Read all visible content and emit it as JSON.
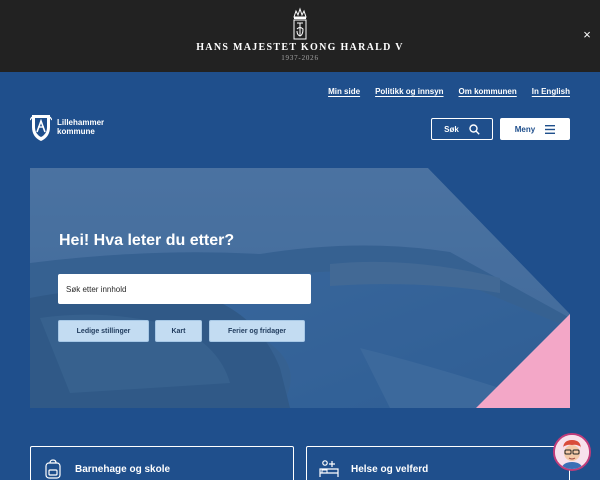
{
  "banner": {
    "title": "HANS MAJESTET KONG HARALD V",
    "years": "1937-2026",
    "close_icon": "×"
  },
  "header": {
    "links": [
      "Min side",
      "Politikk og innsyn",
      "Om kommunen",
      "In English"
    ],
    "logo_line1": "Lillehammer",
    "logo_line2": "kommune",
    "search_label": "Søk",
    "menu_label": "Meny"
  },
  "hero": {
    "title": "Hei! Hva leter du etter?",
    "search_placeholder": "Søk etter innhold",
    "quick_links": [
      "Ledige stillinger",
      "Kart",
      "Ferier og fridager"
    ]
  },
  "cards": [
    {
      "label": "Barnehage og skole",
      "icon": "backpack-icon"
    },
    {
      "label": "Helse og velferd",
      "icon": "care-bed-icon"
    }
  ],
  "colors": {
    "banner_bg": "#222222",
    "primary_blue": "#1f4f8c",
    "chip_bg": "#c3dcf2",
    "accent_pink": "#f3a7c7"
  }
}
